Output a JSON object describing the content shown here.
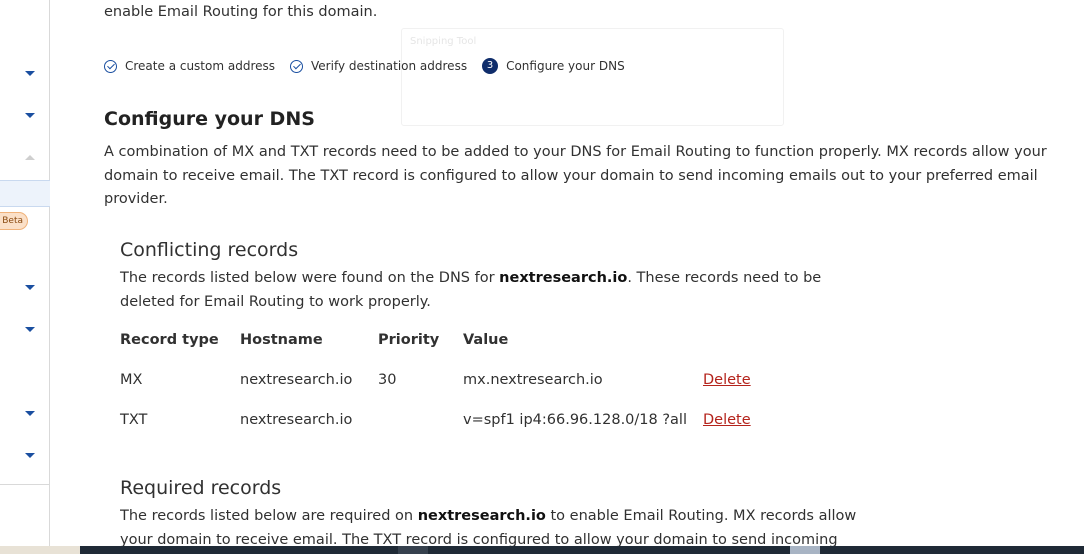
{
  "intro_text": "enable Email Routing for this domain.",
  "steps": [
    {
      "label": "Create a custom address",
      "state": "done"
    },
    {
      "label": "Verify destination address",
      "state": "done"
    },
    {
      "label": "Configure your DNS",
      "state": "current",
      "number": "3"
    }
  ],
  "sidebar": {
    "beta_label": "Beta"
  },
  "ghost_tool_label": "Snipping Tool",
  "configure": {
    "title": "Configure your DNS",
    "description": "A combination of MX and TXT records need to be added to your DNS for Email Routing to function properly. MX records allow your domain to receive email. The TXT record is configured to allow your domain to send incoming emails out to your preferred email provider."
  },
  "conflicting": {
    "title": "Conflicting records",
    "desc_before": "The records listed below were found on the DNS for ",
    "domain": "nextresearch.io",
    "desc_after": ". These records need to be deleted for Email Routing to work properly.",
    "columns": {
      "type": "Record type",
      "hostname": "Hostname",
      "priority": "Priority",
      "value": "Value"
    },
    "rows": [
      {
        "type": "MX",
        "hostname": "nextresearch.io",
        "priority": "30",
        "value": "mx.nextresearch.io",
        "action": "Delete"
      },
      {
        "type": "TXT",
        "hostname": "nextresearch.io",
        "priority": "",
        "value": "v=spf1 ip4:66.96.128.0/18 ?all",
        "action": "Delete"
      }
    ]
  },
  "required": {
    "title": "Required records",
    "desc_before": "The records listed below are required on ",
    "domain": "nextresearch.io",
    "desc_after": " to enable Email Routing. MX records allow your domain to receive email. The TXT record is configured to allow your domain to send incoming emails out"
  },
  "colors": {
    "accent": "#1a4fa0",
    "step_current": "#0f2d6b",
    "danger": "#b4231b",
    "text": "#313131"
  }
}
